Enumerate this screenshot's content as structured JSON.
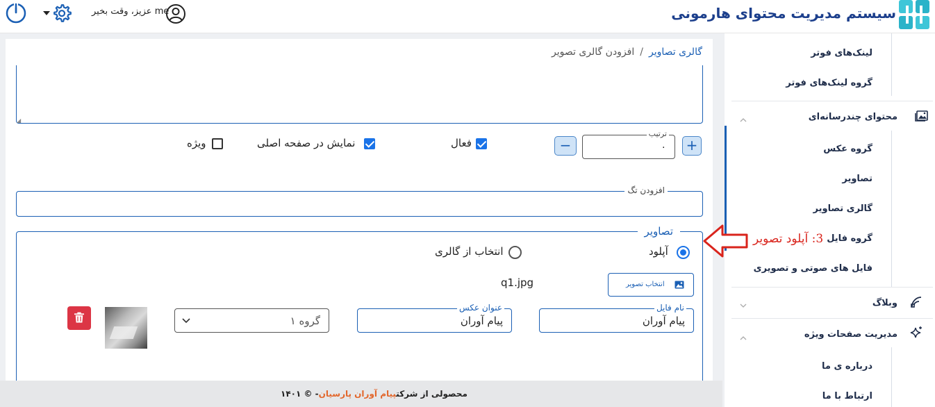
{
  "header": {
    "brand_title": "سیستم مدیریت محتوای هارمونی",
    "greeting": "me عزیز، وقت بخیر",
    "icons": {
      "power": "power-icon",
      "settings": "gear-icon",
      "user": "user-icon",
      "logo": "harmony-logo"
    }
  },
  "breadcrumb": {
    "parent": "گالری تصاویر",
    "separator": "/",
    "current": "افزودن گالری تصویر"
  },
  "form": {
    "order": {
      "label": "ترتیب",
      "value": "۰",
      "plus": "+",
      "minus": "−"
    },
    "checkboxes": [
      {
        "label": "فعال",
        "checked": true
      },
      {
        "label": "نمایش در صفحه اصلی",
        "checked": true
      },
      {
        "label": "ویژه",
        "checked": false
      }
    ],
    "tag": {
      "label": "افزودن تگ",
      "value": ""
    },
    "images": {
      "legend": "تصاویر",
      "radios": [
        {
          "label": "آپلود",
          "selected": true
        },
        {
          "label": "انتخاب از گالری",
          "selected": false
        }
      ],
      "select_button": "انتخاب تصویر",
      "filename": "q1.jpg",
      "file_name_field": {
        "label": "نام فایل",
        "value": "پیام آوران"
      },
      "title_field": {
        "label": "عنوان عکس",
        "value": "پیام آوران"
      },
      "group_select": {
        "value": "گروه ۱"
      }
    }
  },
  "footer": {
    "prefix": "محصولی از شرکت",
    "company": "پیام آوران پارسیان",
    "suffix": "- © ۱۴۰۱"
  },
  "sidebar": {
    "footer_links": "لینک‌های فوتر",
    "footer_link_groups": "گروه لینک‌های فوتر",
    "multimedia": {
      "title": "محتوای چندرسانه‌ای",
      "items": [
        "گروه عکس",
        "تصاویر",
        "گالری تصاویر",
        "گروه فایل",
        "فایل های صوتی و تصویری"
      ]
    },
    "blog": "وبلاگ",
    "special_pages": {
      "title": "مدیریت صفحات ویژه",
      "items": [
        "درباره ی ما",
        "ارتباط با ما"
      ]
    }
  },
  "annotation": {
    "text": "3: آپلود تصویر",
    "color": "#d9241c"
  },
  "colors": {
    "accent": "#1a5fb4",
    "danger": "#dc3545",
    "checkbox": "#1a73e8",
    "brand_orange": "#e2672c"
  }
}
